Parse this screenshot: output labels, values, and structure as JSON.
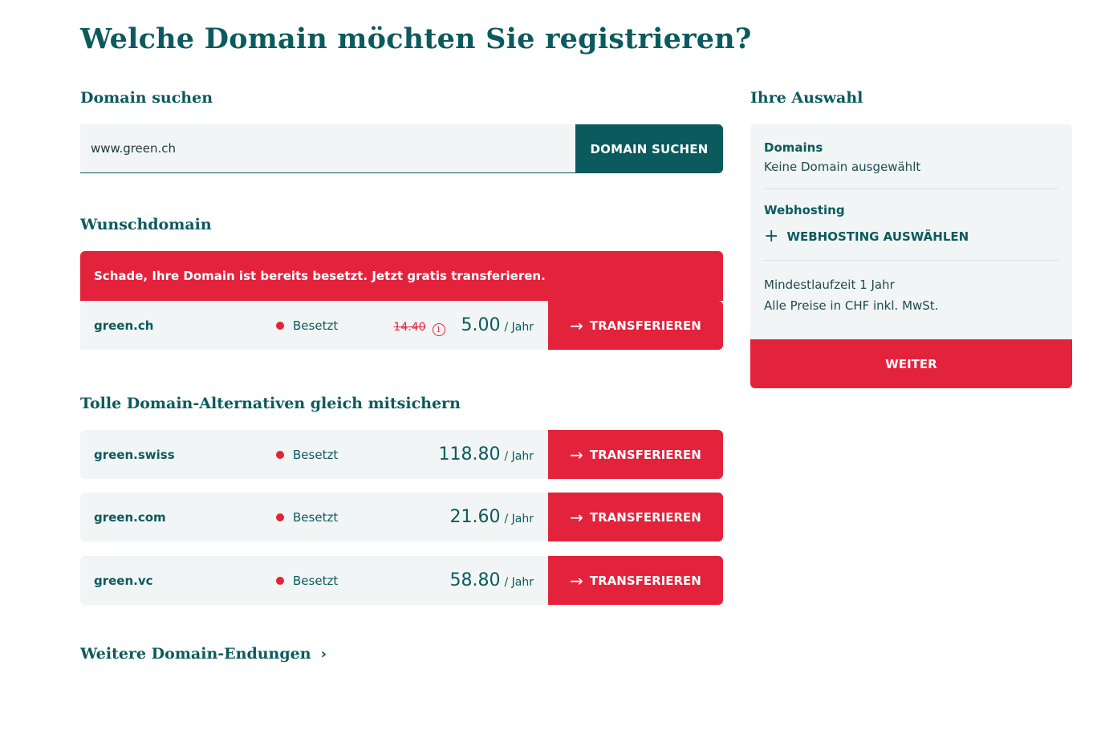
{
  "page": {
    "title": "Welche Domain möchten Sie registrieren?"
  },
  "search": {
    "section_label": "Domain suchen",
    "value": "www.green.ch",
    "button_label": "DOMAIN SUCHEN"
  },
  "wish": {
    "section_label": "Wunschdomain",
    "alert": "Schade, Ihre Domain ist bereits besetzt. Jetzt gratis transferieren.",
    "row": {
      "name": "green.ch",
      "status": "Besetzt",
      "old_price": "14.40",
      "price": "5.00",
      "per": "/ Jahr",
      "action": "TRANSFERIEREN"
    }
  },
  "alternatives": {
    "section_label": "Tolle Domain-Alternativen gleich mitsichern",
    "rows": [
      {
        "name": "green.swiss",
        "status": "Besetzt",
        "price": "118.80",
        "per": "/ Jahr",
        "action": "TRANSFERIEREN"
      },
      {
        "name": "green.com",
        "status": "Besetzt",
        "price": "21.60",
        "per": "/ Jahr",
        "action": "TRANSFERIEREN"
      },
      {
        "name": "green.vc",
        "status": "Besetzt",
        "price": "58.80",
        "per": "/ Jahr",
        "action": "TRANSFERIEREN"
      }
    ]
  },
  "more": {
    "label": "Weitere Domain-Endungen"
  },
  "sidebar": {
    "title": "Ihre Auswahl",
    "domains_label": "Domains",
    "domains_value": "Keine Domain ausgewählt",
    "hosting_label": "Webhosting",
    "hosting_action": "WEBHOSTING AUSWÄHLEN",
    "term": "Mindestlaufzeit 1 Jahr",
    "prices": "Alle Preise in CHF inkl. MwSt.",
    "continue_label": "WEITER"
  },
  "colors": {
    "primary": "#0b5a5e",
    "accent": "#e3223b",
    "surface": "#f2f5f5"
  },
  "icons": {
    "transfer": "arrow-right-icon",
    "status": "status-dot-icon",
    "info": "info-icon",
    "add": "plus-icon",
    "more": "chevron-right-icon"
  }
}
